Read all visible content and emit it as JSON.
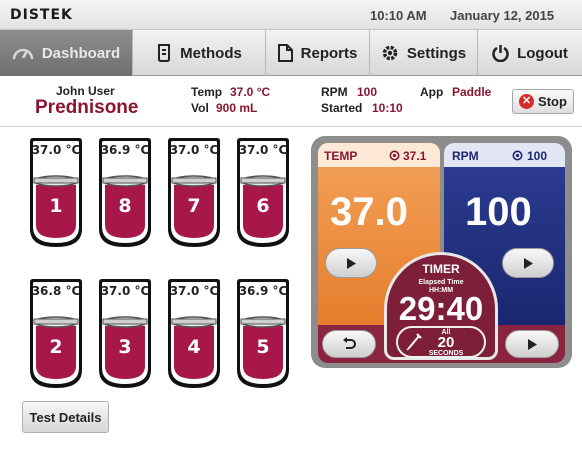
{
  "header": {
    "logo": "DISTEK",
    "time": "10:10 AM",
    "date": "January 12, 2015"
  },
  "nav": [
    {
      "label": "Dashboard",
      "icon": "gauge-icon",
      "active": true
    },
    {
      "label": "Methods",
      "icon": "beaker-icon",
      "active": false
    },
    {
      "label": "Reports",
      "icon": "document-icon",
      "active": false
    },
    {
      "label": "Settings",
      "icon": "gear-icon",
      "active": false
    },
    {
      "label": "Logout",
      "icon": "power-icon",
      "active": false
    }
  ],
  "info": {
    "user": "John User",
    "drug": "Prednisone",
    "temp_label": "Temp",
    "temp_value": "37.0 °C",
    "vol_label": "Vol",
    "vol_value": "900 mL",
    "rpm_label": "RPM",
    "rpm_value": "100",
    "started_label": "Started",
    "started_value": "10:10",
    "app_label": "App",
    "app_value": "Paddle",
    "stop_label": "Stop"
  },
  "vessels": [
    {
      "number": "1",
      "temp": "37.0 °C"
    },
    {
      "number": "8",
      "temp": "36.9 °C"
    },
    {
      "number": "7",
      "temp": "37.0 °C"
    },
    {
      "number": "6",
      "temp": "37.0 °C"
    },
    {
      "number": "2",
      "temp": "36.8 °C"
    },
    {
      "number": "3",
      "temp": "37.0 °C"
    },
    {
      "number": "4",
      "temp": "37.0 °C"
    },
    {
      "number": "5",
      "temp": "36.9 °C"
    }
  ],
  "test_details_label": "Test Details",
  "control": {
    "temp_label": "TEMP",
    "temp_setpoint": "37.1",
    "temp_value": "37.0",
    "rpm_label": "RPM",
    "rpm_setpoint": "100",
    "rpm_value": "100",
    "timer_label": "TIMER",
    "elapsed_line1": "Elapsed Time",
    "elapsed_line2": "HH:MM",
    "timer_value": "29:40",
    "sample_all": "All",
    "sample_seconds": "20",
    "sample_unit": "SECONDS"
  },
  "colors": {
    "accent": "#8b1530",
    "temp_orange": "#e67d2d",
    "rpm_blue": "#1b2670",
    "vessel_fill": "#a8174a"
  }
}
